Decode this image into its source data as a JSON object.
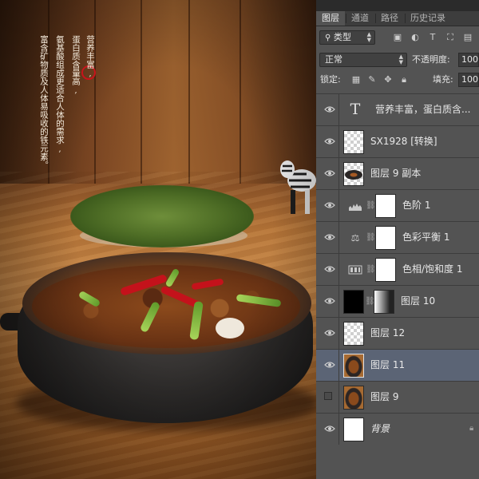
{
  "photo": {
    "poem_lines": [
      "营养丰富,",
      "蛋白质含量高,",
      "氨基酸组成更适合人体的需求,",
      "富含矿物质及人体易吸收的铁元素。"
    ]
  },
  "panel": {
    "tabs": [
      {
        "label": "图层",
        "active": true
      },
      {
        "label": "通道",
        "active": false
      },
      {
        "label": "路径",
        "active": false
      },
      {
        "label": "历史记录",
        "active": false
      }
    ],
    "filter_kind": "类型",
    "blend_mode": "正常",
    "opacity_label": "不透明度:",
    "opacity_value": "100%",
    "lock_label": "锁定:",
    "fill_label": "填充:",
    "fill_value": "100%",
    "layers": [
      {
        "name": "营养丰富，蛋白质含...",
        "visible": true,
        "kind": "text"
      },
      {
        "name": "SX1928 [转换]",
        "visible": true,
        "kind": "transparent"
      },
      {
        "name": "图层 9 副本",
        "visible": true,
        "kind": "food"
      },
      {
        "name": "色阶 1",
        "visible": true,
        "kind": "levels"
      },
      {
        "name": "色彩平衡 1",
        "visible": true,
        "kind": "balance"
      },
      {
        "name": "色相/饱和度 1",
        "visible": true,
        "kind": "huesat"
      },
      {
        "name": "图层 10",
        "visible": true,
        "kind": "masked"
      },
      {
        "name": "图层 12",
        "visible": true,
        "kind": "transparent"
      },
      {
        "name": "图层 11",
        "visible": true,
        "kind": "food",
        "selected": true
      },
      {
        "name": "图层 9",
        "visible": false,
        "kind": "food"
      },
      {
        "name": "背景",
        "visible": true,
        "kind": "background"
      }
    ]
  },
  "colors": {
    "panel_bg": "#535353",
    "selected_row": "#5b6475",
    "poem_marker": "#c8141b"
  }
}
